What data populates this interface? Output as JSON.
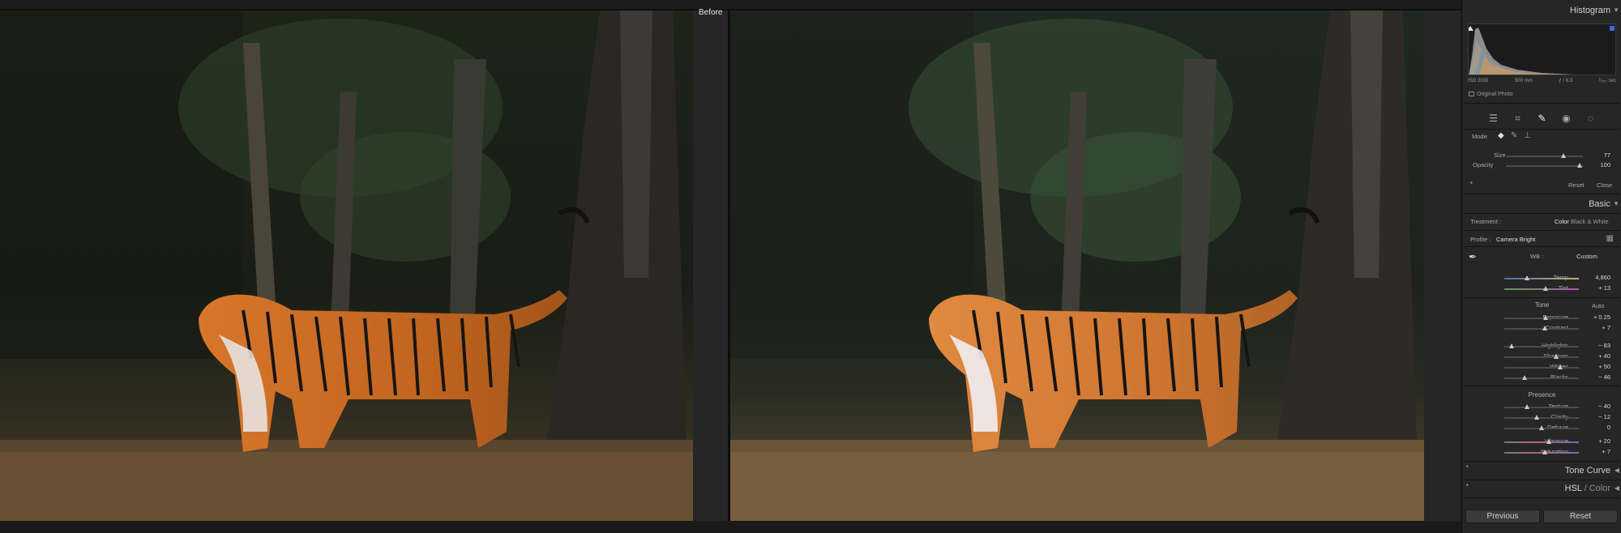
{
  "before_label": "Before",
  "histogram": {
    "title": "Histogram",
    "iso": "ISO 2000",
    "focal": "500 mm",
    "aperture": "ƒ / 6.3",
    "shutter": "¹⁄₂₅₀ sec",
    "original_photo": "Original Photo"
  },
  "healing": {
    "mode_label": "Mode:",
    "size_label": "Size",
    "size_value": "77",
    "opacity_label": "Opacity",
    "opacity_value": "100",
    "reset_label": "Reset",
    "close_label": "Close"
  },
  "basic": {
    "title": "Basic",
    "treatment_label": "Treatment :",
    "treatment_color": "Color",
    "treatment_bw": "Black & White",
    "profile_label": "Profile :",
    "profile_value": "Camera Bright",
    "wb_label": "WB :",
    "wb_value": "Custom",
    "tone_label": "Tone",
    "auto_label": "Auto",
    "presence_label": "Presence",
    "sliders": [
      {
        "name": "Temp",
        "value": "4,860",
        "pos": 0.3
      },
      {
        "name": "Tint",
        "value": "+ 13",
        "pos": 0.55
      },
      {
        "name": "Exposure",
        "value": "+ 0.25",
        "pos": 0.55
      },
      {
        "name": "Contrast",
        "value": "+ 7",
        "pos": 0.54
      },
      {
        "name": "Highlights",
        "value": "− 83",
        "pos": 0.1
      },
      {
        "name": "Shadows",
        "value": "+ 40",
        "pos": 0.7
      },
      {
        "name": "Whites",
        "value": "+ 50",
        "pos": 0.75
      },
      {
        "name": "Blacks",
        "value": "− 46",
        "pos": 0.27
      },
      {
        "name": "Texture",
        "value": "− 40",
        "pos": 0.3
      },
      {
        "name": "Clarity",
        "value": "− 12",
        "pos": 0.44
      },
      {
        "name": "Dehaze",
        "value": "0",
        "pos": 0.5
      },
      {
        "name": "Vibrance",
        "value": "+ 20",
        "pos": 0.6
      },
      {
        "name": "Saturation",
        "value": "+ 7",
        "pos": 0.54
      }
    ]
  },
  "tone_curve": {
    "title": "Tone Curve"
  },
  "hsl": {
    "title_hsl": "HSL",
    "title_sep": " / ",
    "title_color": "Color"
  },
  "buttons": {
    "previous": "Previous",
    "reset": "Reset"
  },
  "colors": {
    "panel_bg": "#262626",
    "accent": "#cfcfcf"
  }
}
